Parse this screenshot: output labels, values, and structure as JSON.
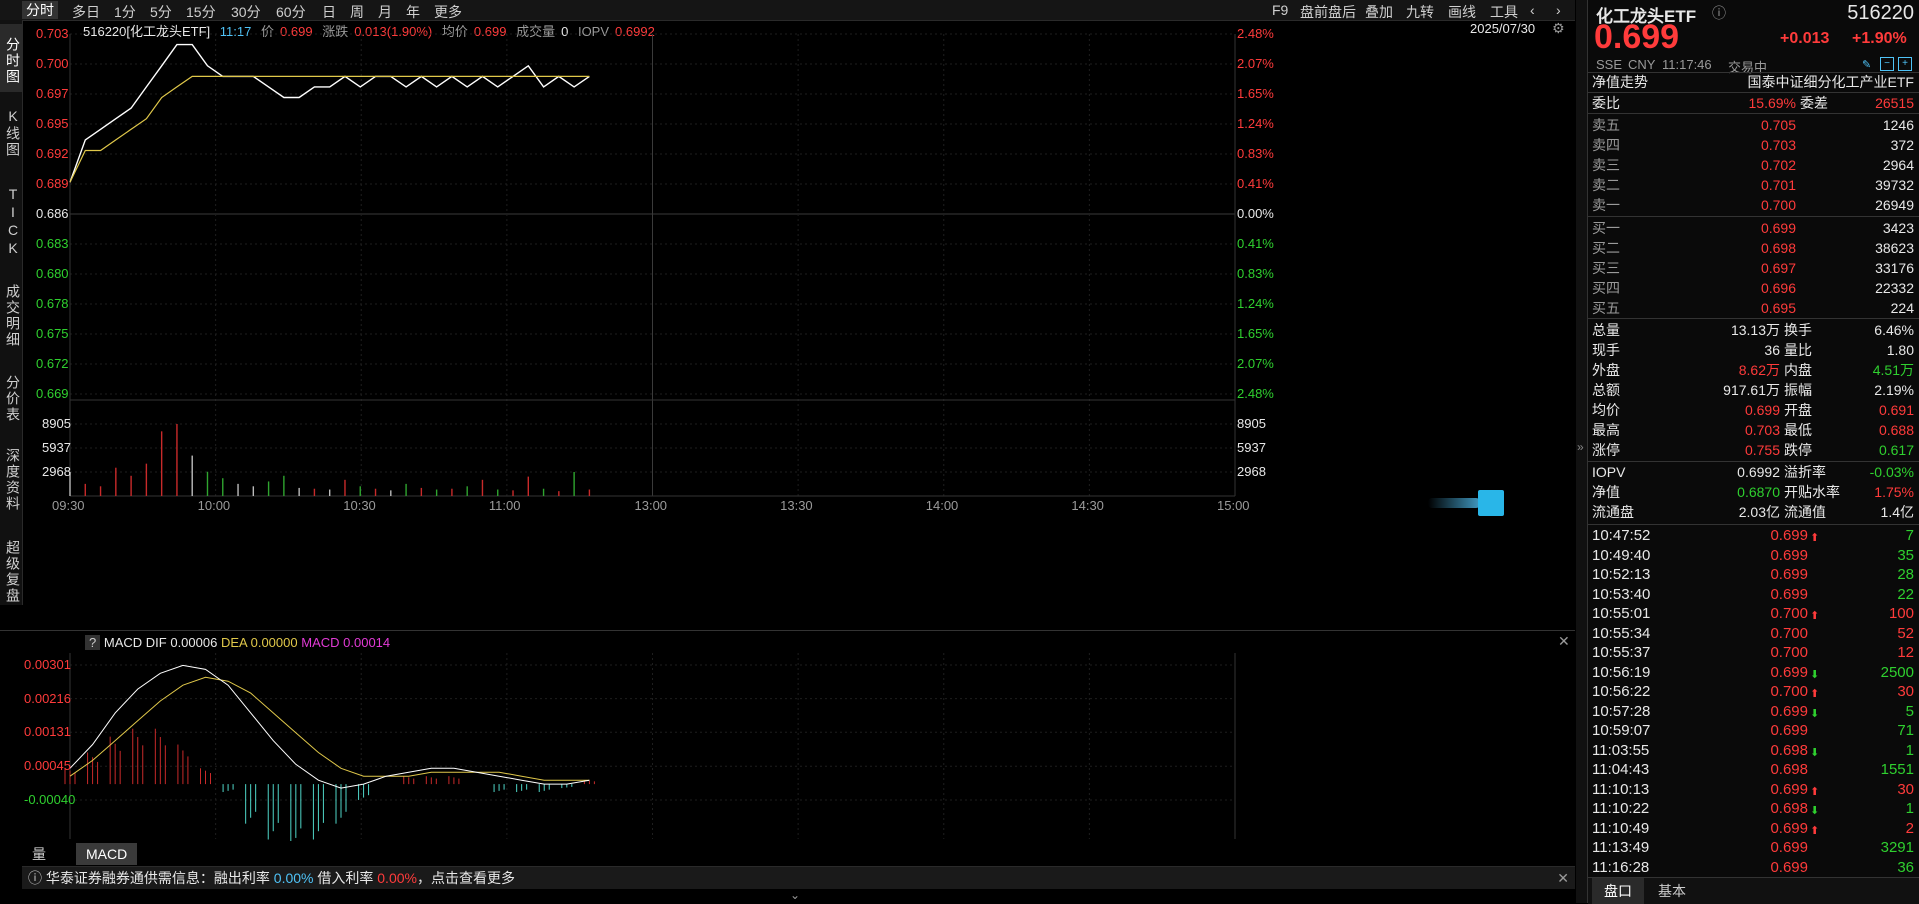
{
  "timeframes": [
    "分时",
    "多日",
    "1分",
    "5分",
    "15分",
    "30分",
    "60分",
    "日",
    "周",
    "月",
    "年",
    "更多"
  ],
  "active_timeframe": "分时",
  "tools": [
    "F9",
    "盘前盘后",
    "叠加",
    "九转",
    "画线",
    "工具"
  ],
  "left_tabs": [
    "分时图",
    "K线图",
    "TICK",
    "成交明细",
    "分价表",
    "深度资料",
    "超级复盘"
  ],
  "info": {
    "code_name": "516220[化工龙头ETF]",
    "time": "11:17",
    "price_label": "价",
    "price": "0.699",
    "change_label": "涨跌",
    "change": "0.013(1.90%)",
    "avg_label": "均价",
    "avg": "0.699",
    "vol_label": "成交量",
    "vol": "0",
    "iopv_label": "IOPV",
    "iopv": "0.6992",
    "date": "2025/07/30"
  },
  "price_axis_left": [
    "0.703",
    "0.700",
    "0.697",
    "0.695",
    "0.692",
    "0.689",
    "0.686",
    "0.683",
    "0.680",
    "0.678",
    "0.675",
    "0.672",
    "0.669"
  ],
  "price_axis_right": [
    "2.48%",
    "2.07%",
    "1.65%",
    "1.24%",
    "0.83%",
    "0.41%",
    "0.00%",
    "0.41%",
    "0.83%",
    "1.24%",
    "1.65%",
    "2.07%",
    "2.48%"
  ],
  "volume_axis": [
    "8905",
    "5937",
    "2968"
  ],
  "time_axis": [
    "09:30",
    "10:00",
    "10:30",
    "11:00",
    "13:00",
    "13:30",
    "14:00",
    "14:30",
    "15:00"
  ],
  "chart_data": {
    "type": "line",
    "title": "",
    "xlabel": "",
    "ylabel": "",
    "ylim": [
      0.669,
      0.703
    ],
    "series": [
      {
        "name": "价",
        "values": [
          0.689,
          0.693,
          0.694,
          0.695,
          0.696,
          0.698,
          0.7,
          0.702,
          0.702,
          0.7,
          0.699,
          0.699,
          0.699,
          0.698,
          0.697,
          0.697,
          0.698,
          0.698,
          0.699,
          0.698,
          0.699,
          0.699,
          0.698,
          0.699,
          0.698,
          0.699,
          0.698,
          0.699,
          0.698,
          0.699,
          0.7,
          0.698,
          0.699,
          0.698,
          0.699
        ]
      },
      {
        "name": "均价",
        "values": [
          0.689,
          0.692,
          0.692,
          0.693,
          0.694,
          0.695,
          0.697,
          0.698,
          0.699,
          0.699,
          0.699,
          0.699,
          0.699,
          0.699,
          0.699,
          0.699,
          0.699,
          0.699,
          0.699,
          0.699,
          0.699,
          0.699,
          0.699,
          0.699,
          0.699,
          0.699,
          0.699,
          0.699,
          0.699,
          0.699,
          0.699,
          0.699,
          0.699,
          0.699,
          0.699
        ]
      }
    ],
    "volume_series": [
      2968,
      1500,
      1200,
      3500,
      2500,
      4000,
      8000,
      8905,
      5000,
      3000,
      2200,
      1500,
      1200,
      1800,
      2500,
      1000,
      900,
      800,
      2000,
      1200,
      900,
      700,
      1500,
      1000,
      800,
      900,
      1200,
      2000,
      800,
      700,
      2400,
      900,
      600,
      2968,
      800
    ]
  },
  "macd": {
    "q_label": "?",
    "title": "MACD",
    "dif_label": "DIF",
    "dif": "0.00006",
    "dea_label": "DEA",
    "dea": "0.00000",
    "macd_label": "MACD",
    "macd_val": "0.00014",
    "axis": [
      "0.00301",
      "0.00216",
      "0.00131",
      "0.00045",
      "-0.00040"
    ],
    "dif_series": [
      0.0004,
      0.001,
      0.0018,
      0.0024,
      0.0028,
      0.003,
      0.0029,
      0.0025,
      0.0018,
      0.0011,
      0.0005,
      0.0001,
      -0.0001,
      0.0,
      0.0002,
      0.0003,
      0.0004,
      0.0004,
      0.0003,
      0.0002,
      0.0001,
      0.0,
      0.0,
      0.0001
    ],
    "dea_series": [
      0.0002,
      0.0006,
      0.0011,
      0.0016,
      0.0021,
      0.0025,
      0.0027,
      0.0026,
      0.0023,
      0.0018,
      0.0013,
      0.0008,
      0.0004,
      0.0002,
      0.0002,
      0.0002,
      0.0003,
      0.0003,
      0.0003,
      0.0003,
      0.0002,
      0.0001,
      0.0001,
      0.0001
    ],
    "hist_series": [
      0.0004,
      0.0008,
      0.0012,
      0.0014,
      0.0014,
      0.001,
      0.0004,
      -0.0002,
      -0.001,
      -0.0014,
      -0.0016,
      -0.0014,
      -0.001,
      -0.0004,
      0.0,
      0.0002,
      0.0002,
      0.0002,
      0.0,
      -0.0002,
      -0.0002,
      -0.0002,
      -0.0001,
      0.0001
    ]
  },
  "bottom_tabs": [
    "量比",
    "MACD"
  ],
  "active_bottom_tab": "MACD",
  "news": {
    "text1": "华泰证券融券通供需信息：融出利率",
    "rate1": "0.00%",
    "text2": "借入利率",
    "rate2": "0.00%",
    "text3": "，点击查看更多"
  },
  "right": {
    "name": "化工龙头ETF",
    "code": "516220",
    "price": "0.699",
    "change": "+0.013",
    "change_pct": "+1.90%",
    "exchange": "SSE",
    "currency": "CNY",
    "time": "11:17:46",
    "status": "交易中",
    "nav_trend_label": "净值走势",
    "index_name": "国泰中证细分化工产业ETF",
    "webi_label": "委比",
    "webi": "15.69%",
    "weicha_label": "委差",
    "weicha": "26515",
    "asks": [
      {
        "label": "卖五",
        "price": "0.705",
        "vol": "1246"
      },
      {
        "label": "卖四",
        "price": "0.703",
        "vol": "372"
      },
      {
        "label": "卖三",
        "price": "0.702",
        "vol": "2964"
      },
      {
        "label": "卖二",
        "price": "0.701",
        "vol": "39732"
      },
      {
        "label": "卖一",
        "price": "0.700",
        "vol": "26949"
      }
    ],
    "bids": [
      {
        "label": "买一",
        "price": "0.699",
        "vol": "3423"
      },
      {
        "label": "买二",
        "price": "0.698",
        "vol": "38623"
      },
      {
        "label": "买三",
        "price": "0.697",
        "vol": "33176"
      },
      {
        "label": "买四",
        "price": "0.696",
        "vol": "22332"
      },
      {
        "label": "买五",
        "price": "0.695",
        "vol": "224"
      }
    ],
    "stats": [
      {
        "l1": "总量",
        "v1": "13.13万",
        "c1": "white",
        "l2": "换手",
        "v2": "6.46%",
        "c2": "white"
      },
      {
        "l1": "现手",
        "v1": "36",
        "c1": "white",
        "l2": "量比",
        "v2": "1.80",
        "c2": "white"
      },
      {
        "l1": "外盘",
        "v1": "8.62万",
        "c1": "red",
        "l2": "内盘",
        "v2": "4.51万",
        "c2": "green"
      },
      {
        "l1": "总额",
        "v1": "917.61万",
        "c1": "white",
        "l2": "振幅",
        "v2": "2.19%",
        "c2": "white"
      },
      {
        "l1": "均价",
        "v1": "0.699",
        "c1": "red",
        "l2": "开盘",
        "v2": "0.691",
        "c2": "red"
      },
      {
        "l1": "最高",
        "v1": "0.703",
        "c1": "red",
        "l2": "最低",
        "v2": "0.688",
        "c2": "red"
      },
      {
        "l1": "涨停",
        "v1": "0.755",
        "c1": "red",
        "l2": "跌停",
        "v2": "0.617",
        "c2": "green"
      }
    ],
    "stats2": [
      {
        "l1": "IOPV",
        "v1": "0.6992",
        "c1": "white",
        "l2": "溢折率",
        "v2": "-0.03%",
        "c2": "green"
      },
      {
        "l1": "净值",
        "v1": "0.6870",
        "c1": "green",
        "l2": "开贴水率",
        "v2": "1.75%",
        "c2": "red"
      },
      {
        "l1": "流通盘",
        "v1": "2.03亿",
        "c1": "white",
        "l2": "流通值",
        "v2": "1.4亿",
        "c2": "white"
      }
    ],
    "ticks": [
      {
        "time": "10:47:52",
        "price": "0.699",
        "arrow": "up",
        "vol": "7",
        "vc": "green"
      },
      {
        "time": "10:49:40",
        "price": "0.699",
        "arrow": "",
        "vol": "35",
        "vc": "green"
      },
      {
        "time": "10:52:13",
        "price": "0.699",
        "arrow": "",
        "vol": "28",
        "vc": "green"
      },
      {
        "time": "10:53:40",
        "price": "0.699",
        "arrow": "",
        "vol": "22",
        "vc": "green"
      },
      {
        "time": "10:55:01",
        "price": "0.700",
        "arrow": "up",
        "vol": "100",
        "vc": "red"
      },
      {
        "time": "10:55:34",
        "price": "0.700",
        "arrow": "",
        "vol": "52",
        "vc": "red"
      },
      {
        "time": "10:55:37",
        "price": "0.700",
        "arrow": "",
        "vol": "12",
        "vc": "red"
      },
      {
        "time": "10:56:19",
        "price": "0.699",
        "arrow": "down",
        "vol": "2500",
        "vc": "green"
      },
      {
        "time": "10:56:22",
        "price": "0.700",
        "arrow": "up",
        "vol": "30",
        "vc": "red"
      },
      {
        "time": "10:57:28",
        "price": "0.699",
        "arrow": "down",
        "vol": "5",
        "vc": "green"
      },
      {
        "time": "10:59:07",
        "price": "0.699",
        "arrow": "",
        "vol": "71",
        "vc": "green"
      },
      {
        "time": "11:03:55",
        "price": "0.698",
        "arrow": "down",
        "vol": "1",
        "vc": "green"
      },
      {
        "time": "11:04:43",
        "price": "0.698",
        "arrow": "",
        "vol": "1551",
        "vc": "green"
      },
      {
        "time": "11:10:13",
        "price": "0.699",
        "arrow": "up",
        "vol": "30",
        "vc": "red"
      },
      {
        "time": "11:10:22",
        "price": "0.698",
        "arrow": "down",
        "vol": "1",
        "vc": "green"
      },
      {
        "time": "11:10:49",
        "price": "0.699",
        "arrow": "up",
        "vol": "2",
        "vc": "red"
      },
      {
        "time": "11:13:49",
        "price": "0.699",
        "arrow": "",
        "vol": "3291",
        "vc": "green"
      },
      {
        "time": "11:16:28",
        "price": "0.699",
        "arrow": "",
        "vol": "36",
        "vc": "green"
      }
    ],
    "bottom_tabs": [
      "盘口",
      "基本"
    ],
    "active_tab": "盘口"
  },
  "colors": {
    "up": "#ff3b3b",
    "down": "#2fd02f",
    "price_line": "#ffffff",
    "avg_line": "#e0c84a",
    "dif": "#ffffff",
    "dea": "#e0c84a"
  }
}
